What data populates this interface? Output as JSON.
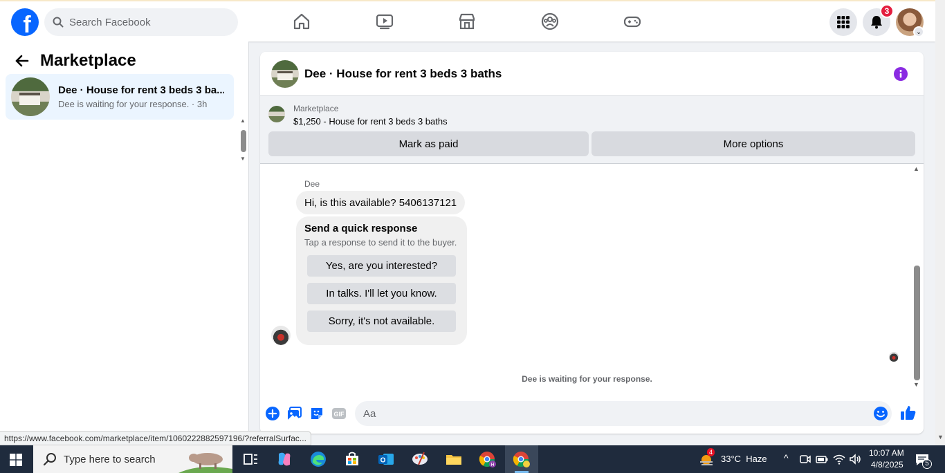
{
  "topbar": {
    "search_placeholder": "Search Facebook",
    "notification_count": "3",
    "nav_icons": [
      "home-icon",
      "video-icon",
      "marketplace-icon",
      "groups-icon",
      "gaming-icon"
    ]
  },
  "sidebar": {
    "title": "Marketplace",
    "conversations": [
      {
        "name": "Dee · House for rent 3 beds 3 ba...",
        "status": "Dee is waiting for your response. · 3h"
      }
    ]
  },
  "chat": {
    "title": "Dee · House for rent 3 beds 3 baths",
    "listing": {
      "label": "Marketplace",
      "price_title": "$1,250 - House for rent 3 beds 3 baths"
    },
    "actions": {
      "mark_paid": "Mark as paid",
      "more_options": "More options"
    },
    "messages": [
      {
        "sender": "Dee",
        "text": "Hi, is this available? 5406137121"
      }
    ],
    "quick_response": {
      "title": "Send a quick response",
      "subtitle": "Tap a response to send it to the buyer.",
      "options": [
        "Yes, are you interested?",
        "In talks. I'll let you know.",
        "Sorry, it's not available."
      ]
    },
    "waiting_note": "Dee is waiting for your response.",
    "composer_placeholder": "Aa"
  },
  "status_url": "https://www.facebook.com/marketplace/item/1060222882597196/?referralSurfac...",
  "taskbar": {
    "search_placeholder": "Type here to search",
    "weather_badge": "4",
    "weather": "33°C  Haze",
    "time": "10:07 AM",
    "date": "4/8/2025",
    "notification_count": "5"
  },
  "colors": {
    "brand": "#0866ff",
    "accent_purple": "#8a2be2",
    "badge_red": "#e41e3f"
  }
}
